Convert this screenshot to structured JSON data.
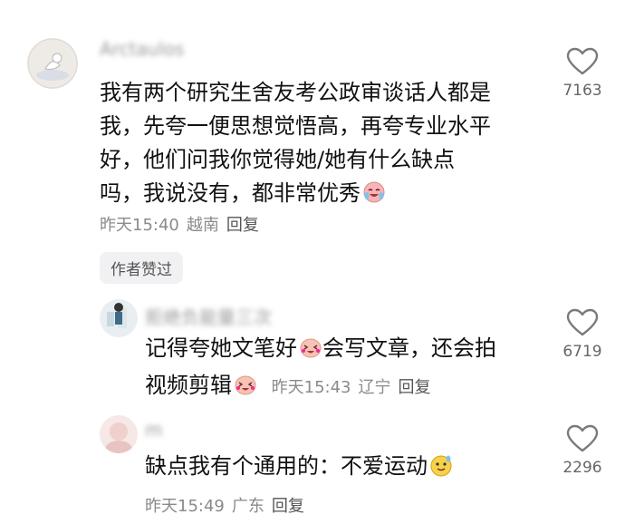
{
  "comments": [
    {
      "username": "Arctaulos",
      "text_lines": [
        "我有两个研究生舍友考公政审谈话人都是",
        "我，先夸一便思想觉悟高，再夸专业水平",
        "好，他们问我你觉得她/她有什么缺点",
        "吗，我说没有，都非常优秀"
      ],
      "emoji": "crying-laughing-emoji",
      "time": "昨天15:40",
      "location": "越南",
      "reply_label": "回复",
      "author_liked_label": "作者赞过",
      "likes": "7163"
    },
    {
      "username": "拒绝负能量三次",
      "text_part1": "记得夸她文笔好",
      "emoji1": "laughing-blush-emoji",
      "text_part2": "会写文章，还会拍",
      "text_part3": "视频剪辑",
      "emoji2": "laughing-blush-emoji",
      "time": "昨天15:43",
      "location": "辽宁",
      "reply_label": "回复",
      "likes": "6719"
    },
    {
      "username": "m",
      "text": "缺点我有个通用的：不爱运动",
      "emoji": "sweat-smile-emoji",
      "time": "昨天15:49",
      "location": "广东",
      "reply_label": "回复",
      "likes": "2296"
    }
  ],
  "colors": {
    "text": "#111111",
    "meta": "#8a8a8a",
    "chip_bg": "#f1f1f3",
    "heart": "#7a7a7a"
  }
}
